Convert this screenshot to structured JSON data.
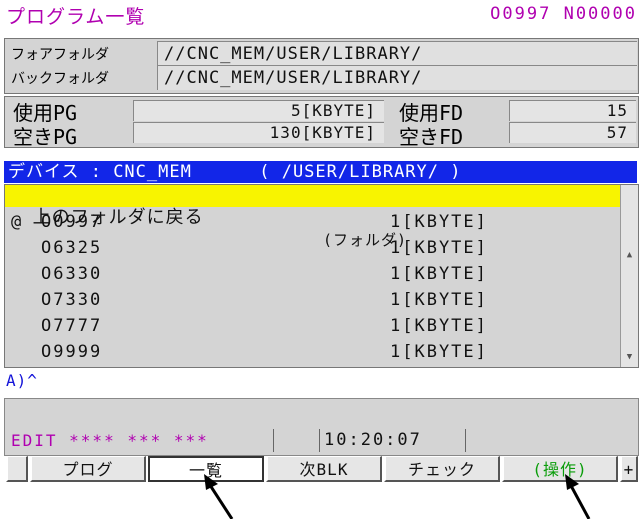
{
  "header": {
    "title": "プログラム一覧",
    "program_status": "O0997 N00000"
  },
  "folders": {
    "current_label": "フォアフォルダ",
    "current_path": "//CNC_MEM/USER/LIBRARY/",
    "back_label": "バックフォルダ",
    "back_path": "//CNC_MEM/USER/LIBRARY/"
  },
  "usage": {
    "used_pg_label": "使用PG",
    "used_pg_value": "5[KBYTE]",
    "free_pg_label": "空きPG",
    "free_pg_value": "130[KBYTE]",
    "used_fd_label": "使用FD",
    "used_fd_value": "15",
    "free_fd_label": "空きFD",
    "free_fd_value": "57"
  },
  "device_bar": "デバイス : CNC_MEM      ( /USER/LIBRARY/ )",
  "list": {
    "parent_name": "  上のフォルダに戻る",
    "parent_type": "(フォルダ)",
    "rows": [
      {
        "mark": "@",
        "name": "O0997",
        "size": "1[KBYTE]"
      },
      {
        "mark": "",
        "name": "O6325",
        "size": "1[KBYTE]"
      },
      {
        "mark": "",
        "name": "O6330",
        "size": "1[KBYTE]"
      },
      {
        "mark": "",
        "name": "O7330",
        "size": "1[KBYTE]"
      },
      {
        "mark": "",
        "name": "O7777",
        "size": "1[KBYTE]"
      },
      {
        "mark": "",
        "name": "O9999",
        "size": "1[KBYTE]"
      }
    ]
  },
  "input_line": "A)^",
  "status": {
    "mode": "EDIT **** *** ***",
    "time": "10:20:07"
  },
  "softkeys": [
    "",
    "プログ",
    "一覧",
    "次BLK",
    "チェック",
    "(操作)",
    "+"
  ],
  "colors": {
    "title": "#b000b0",
    "device_bar": "#1226e8",
    "highlight": "#f8f400",
    "operate": "#0a9d0a"
  }
}
